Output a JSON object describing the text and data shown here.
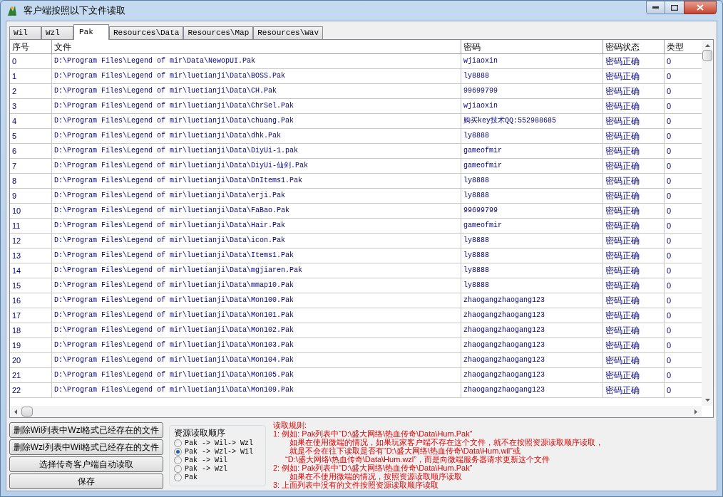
{
  "window": {
    "title": "客户端按照以下文件读取"
  },
  "tabs": [
    {
      "label": "Wil",
      "selected": false
    },
    {
      "label": "Wzl",
      "selected": false
    },
    {
      "label": "Pak",
      "selected": true
    },
    {
      "label": "Resources\\Data",
      "selected": false
    },
    {
      "label": "Resources\\Map",
      "selected": false
    },
    {
      "label": "Resources\\Wav",
      "selected": false
    }
  ],
  "table": {
    "columns": [
      "序号",
      "文件",
      "密码",
      "密码状态",
      "类型"
    ],
    "rows": [
      [
        "0",
        "D:\\Program Files\\Legend of mir\\Data\\NewopUI.Pak",
        "wjiaoxin",
        "密码正确",
        "0"
      ],
      [
        "1",
        "D:\\Program Files\\Legend of mir\\luetianji\\Data\\BOSS.Pak",
        "ly8888",
        "密码正确",
        "0"
      ],
      [
        "2",
        "D:\\Program Files\\Legend of mir\\luetianji\\Data\\CH.Pak",
        "99699799",
        "密码正确",
        "0"
      ],
      [
        "3",
        "D:\\Program Files\\Legend of mir\\luetianji\\Data\\ChrSel.Pak",
        "wjiaoxin",
        "密码正确",
        "0"
      ],
      [
        "4",
        "D:\\Program Files\\Legend of mir\\luetianji\\Data\\chuang.Pak",
        "购买key技术QQ:552988685",
        "密码正确",
        "0"
      ],
      [
        "5",
        "D:\\Program Files\\Legend of mir\\luetianji\\Data\\dhk.Pak",
        "ly8888",
        "密码正确",
        "0"
      ],
      [
        "6",
        "D:\\Program Files\\Legend of mir\\luetianji\\Data\\DiyUi-1.pak",
        "gameofmir",
        "密码正确",
        "0"
      ],
      [
        "7",
        "D:\\Program Files\\Legend of mir\\luetianji\\Data\\DiyUi-仙剑.Pak",
        "gameofmir",
        "密码正确",
        "0"
      ],
      [
        "8",
        "D:\\Program Files\\Legend of mir\\luetianji\\Data\\DnItems1.Pak",
        "ly8888",
        "密码正确",
        "0"
      ],
      [
        "9",
        "D:\\Program Files\\Legend of mir\\luetianji\\Data\\erji.Pak",
        "ly8888",
        "密码正确",
        "0"
      ],
      [
        "10",
        "D:\\Program Files\\Legend of mir\\luetianji\\Data\\FaBao.Pak",
        "99699799",
        "密码正确",
        "0"
      ],
      [
        "11",
        "D:\\Program Files\\Legend of mir\\luetianji\\Data\\Hair.Pak",
        "gameofmir",
        "密码正确",
        "0"
      ],
      [
        "12",
        "D:\\Program Files\\Legend of mir\\luetianji\\Data\\icon.Pak",
        "ly8888",
        "密码正确",
        "0"
      ],
      [
        "13",
        "D:\\Program Files\\Legend of mir\\luetianji\\Data\\Items1.Pak",
        "ly8888",
        "密码正确",
        "0"
      ],
      [
        "14",
        "D:\\Program Files\\Legend of mir\\luetianji\\Data\\mgjiaren.Pak",
        "ly8888",
        "密码正确",
        "0"
      ],
      [
        "15",
        "D:\\Program Files\\Legend of mir\\luetianji\\Data\\mmap10.Pak",
        "ly8888",
        "密码正确",
        "0"
      ],
      [
        "16",
        "D:\\Program Files\\Legend of mir\\luetianji\\Data\\Mon100.Pak",
        "zhaogangzhaogang123",
        "密码正确",
        "0"
      ],
      [
        "17",
        "D:\\Program Files\\Legend of mir\\luetianji\\Data\\Mon101.Pak",
        "zhaogangzhaogang123",
        "密码正确",
        "0"
      ],
      [
        "18",
        "D:\\Program Files\\Legend of mir\\luetianji\\Data\\Mon102.Pak",
        "zhaogangzhaogang123",
        "密码正确",
        "0"
      ],
      [
        "19",
        "D:\\Program Files\\Legend of mir\\luetianji\\Data\\Mon103.Pak",
        "zhaogangzhaogang123",
        "密码正确",
        "0"
      ],
      [
        "20",
        "D:\\Program Files\\Legend of mir\\luetianji\\Data\\Mon104.Pak",
        "zhaogangzhaogang123",
        "密码正确",
        "0"
      ],
      [
        "21",
        "D:\\Program Files\\Legend of mir\\luetianji\\Data\\Mon105.Pak",
        "zhaogangzhaogang123",
        "密码正确",
        "0"
      ],
      [
        "22",
        "D:\\Program Files\\Legend of mir\\luetianji\\Data\\Mon109.Pak",
        "zhaogangzhaogang123",
        "密码正确",
        "0"
      ]
    ]
  },
  "buttons": [
    "删除Wil列表中Wzl格式已经存在的文件",
    "删除Wzl列表中Wil格式已经存在的文件",
    "选择传奇客户端自动读取",
    "保存"
  ],
  "read_order": {
    "title": "资源读取顺序",
    "options": [
      {
        "label": "Pak -> Wil-> Wzl",
        "selected": false
      },
      {
        "label": "Pak -> Wzl-> Wil",
        "selected": true
      },
      {
        "label": "Pak -> Wil",
        "selected": false
      },
      {
        "label": "Pak -> Wzl",
        "selected": false
      },
      {
        "label": "Pak",
        "selected": false
      }
    ]
  },
  "rules": {
    "title": "读取规则:",
    "lines": [
      {
        "kind": "item",
        "text": "1: 例如: Pak列表中“D:\\盛大网络\\热血传奇\\Data\\Hum.Pak”"
      },
      {
        "kind": "detail",
        "text": "如果在使用微端的情况，如果玩家客户端不存在这个文件，就不在按照资源读取顺序读取，"
      },
      {
        "kind": "detail",
        "text": "就是不会在往下读取是否有“D:\\盛大网络\\热血传奇\\Data\\Hum.wil”或"
      },
      {
        "kind": "quote",
        "text": "“D:\\盛大网络\\热血传奇\\Data\\Hum.wzl”，而是向微端服务器请求更新这个文件"
      },
      {
        "kind": "item",
        "text": "2: 例如: Pak列表中“D:\\盛大网络\\热血传奇\\Data\\Hum.Pak”"
      },
      {
        "kind": "detail",
        "text": "如果在不使用微端的情况，按照资源读取顺序读取"
      },
      {
        "kind": "item",
        "text": "3: 上面列表中没有的文件按照资源读取顺序读取"
      }
    ]
  }
}
